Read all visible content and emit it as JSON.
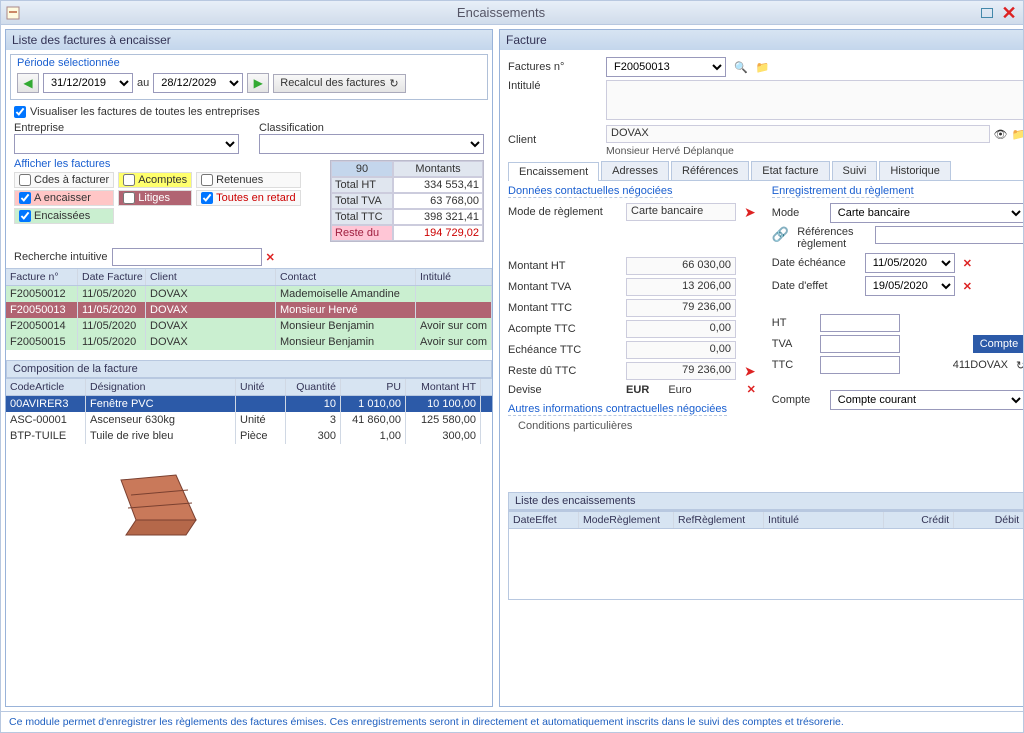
{
  "window": {
    "title": "Encaissements"
  },
  "left": {
    "title": "Liste des factures à encaisser",
    "period": {
      "label": "Période sélectionnée",
      "from": "31/12/2019",
      "to": "28/12/2029",
      "au": "au",
      "recalc": "Recalcul des factures"
    },
    "visualiser": "Visualiser les factures de toutes les entreprises",
    "entreprise": "Entreprise",
    "classification": "Classification",
    "afficher": "Afficher les factures",
    "filters": {
      "cdes": "Cdes à facturer",
      "acomptes": "Acomptes",
      "retenues": "Retenues",
      "aencaisser": "A encaisser",
      "litiges": "Litiges",
      "toutes": "Toutes en retard",
      "encaissees": "Encaissées"
    },
    "totals": {
      "count": "90",
      "montants": "Montants",
      "ht_l": "Total HT",
      "ht": "334 553,41",
      "tva_l": "Total TVA",
      "tva": "63 768,00",
      "ttc_l": "Total TTC",
      "ttc": "398 321,41",
      "reste_l": "Reste du",
      "reste": "194 729,02"
    },
    "search": "Recherche intuitive",
    "cols": {
      "num": "Facture n°",
      "date": "Date Facture",
      "client": "Client",
      "contact": "Contact",
      "intitule": "Intitulé"
    },
    "rows": [
      {
        "num": "F20050012",
        "date": "11/05/2020",
        "client": "DOVAX",
        "contact": "Mademoiselle Amandine",
        "intitule": ""
      },
      {
        "num": "F20050013",
        "date": "11/05/2020",
        "client": "DOVAX",
        "contact": "Monsieur Hervé",
        "intitule": ""
      },
      {
        "num": "F20050014",
        "date": "11/05/2020",
        "client": "DOVAX",
        "contact": "Monsieur Benjamin",
        "intitule": "Avoir sur com"
      },
      {
        "num": "F20050015",
        "date": "11/05/2020",
        "client": "DOVAX",
        "contact": "Monsieur Benjamin",
        "intitule": "Avoir sur com"
      }
    ],
    "comp_title": "Composition de la facture",
    "comp_cols": {
      "code": "CodeArticle",
      "des": "Désignation",
      "unite": "Unité",
      "qte": "Quantité",
      "pu": "PU",
      "mht": "Montant HT"
    },
    "comp_rows": [
      {
        "code": "00AVIRER3",
        "des": "Fenêtre PVC",
        "unite": "",
        "qte": "10",
        "pu": "1 010,00",
        "mht": "10 100,00"
      },
      {
        "code": "ASC-00001",
        "des": "Ascenseur 630kg",
        "unite": "Unité",
        "qte": "3",
        "pu": "41 860,00",
        "mht": "125 580,00"
      },
      {
        "code": "BTP-TUILE",
        "des": "Tuile de rive bleu",
        "unite": "Pièce",
        "qte": "300",
        "pu": "1,00",
        "mht": "300,00"
      }
    ]
  },
  "right": {
    "title": "Facture",
    "facture_n": "Factures n°",
    "facture_v": "F20050013",
    "intitule": "Intitulé",
    "client": "Client",
    "client_v": "DOVAX",
    "client_sub": "Monsieur Hervé Déplanque",
    "tabs": [
      "Encaissement",
      "Adresses",
      "Références",
      "Etat facture",
      "Suivi",
      "Historique"
    ],
    "g1": "Données contactuelles négociées",
    "g2": "Enregistrement du règlement",
    "mode_l": "Mode de règlement",
    "mode_v": "Carte bancaire",
    "mode2_l": "Mode",
    "mode2_v": "Carte bancaire",
    "ref_l": "Références règlement",
    "deche_l": "Date échéance",
    "deche_v": "11/05/2020",
    "deff_l": "Date d'effet",
    "deff_v": "19/05/2020",
    "mht_l": "Montant HT",
    "mht_v": "66 030,00",
    "mtva_l": "Montant TVA",
    "mtva_v": "13 206,00",
    "mttc_l": "Montant TTC",
    "mttc_v": "79 236,00",
    "ac_l": "Acompte TTC",
    "ac_v": "0,00",
    "ech_l": "Echéance TTC",
    "ech_v": "0,00",
    "reste_l": "Reste dû TTC",
    "reste_v": "79 236,00",
    "dev_l": "Devise",
    "dev_v": "EUR",
    "dev_t": "Euro",
    "autres": "Autres informations contractuelles négociées",
    "cond": "Conditions particulières",
    "ht_l": "HT",
    "tva_l": "TVA",
    "ttc_l": "TTC",
    "compte_btn": "Compte",
    "compte_val": "411DOVAX",
    "compte_l": "Compte",
    "compte_v": "Compte courant",
    "enc_title": "Liste des encaissements",
    "enc_cols": {
      "date": "DateEffet",
      "mode": "ModeRèglement",
      "ref": "RefRèglement",
      "int": "Intitulé",
      "credit": "Crédit",
      "debit": "Débit"
    }
  },
  "footer": "Ce module permet d'enregistrer les règlements des factures émises. Ces enregistrements seront in directement et automatiquement inscrits dans le suivi des comptes et trésorerie."
}
